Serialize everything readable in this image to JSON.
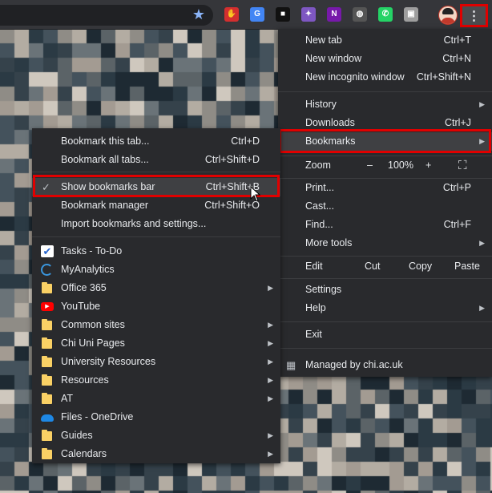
{
  "toolbar": {
    "menu_icon": "⋮",
    "extensions": [
      {
        "name": "adblock-icon",
        "glyph": "✋",
        "color": "#d32f2f"
      },
      {
        "name": "translate-icon",
        "glyph": "G",
        "color": "#4285f4"
      },
      {
        "name": "square-ext-icon",
        "glyph": "■",
        "color": "#111111"
      },
      {
        "name": "puzzle-icon",
        "glyph": "✦",
        "color": "#7e57c2"
      },
      {
        "name": "onenote-icon",
        "glyph": "N",
        "color": "#7719aa"
      },
      {
        "name": "lightbulb-icon",
        "glyph": "◍",
        "color": "#555555"
      },
      {
        "name": "whatsapp-icon",
        "glyph": "✆",
        "color": "#25d366"
      },
      {
        "name": "app-ext-icon",
        "glyph": "▣",
        "color": "#9e9e9e"
      }
    ]
  },
  "chrome_menu": {
    "new_tab": {
      "label": "New tab",
      "shortcut": "Ctrl+T"
    },
    "new_window": {
      "label": "New window",
      "shortcut": "Ctrl+N"
    },
    "new_incognito": {
      "label": "New incognito window",
      "shortcut": "Ctrl+Shift+N"
    },
    "history": {
      "label": "History"
    },
    "downloads": {
      "label": "Downloads",
      "shortcut": "Ctrl+J"
    },
    "bookmarks": {
      "label": "Bookmarks"
    },
    "zoom": {
      "label": "Zoom",
      "minus": "–",
      "value": "100%",
      "plus": "+",
      "fullscreen": "⛶"
    },
    "print": {
      "label": "Print...",
      "shortcut": "Ctrl+P"
    },
    "cast": {
      "label": "Cast..."
    },
    "find": {
      "label": "Find...",
      "shortcut": "Ctrl+F"
    },
    "more_tools": {
      "label": "More tools"
    },
    "edit": {
      "label": "Edit",
      "cut": "Cut",
      "copy": "Copy",
      "paste": "Paste"
    },
    "settings": {
      "label": "Settings"
    },
    "help": {
      "label": "Help"
    },
    "exit": {
      "label": "Exit"
    },
    "managed": {
      "label": "Managed by chi.ac.uk"
    }
  },
  "bookmarks_menu": {
    "bookmark_tab": {
      "label": "Bookmark this tab...",
      "shortcut": "Ctrl+D"
    },
    "bookmark_all": {
      "label": "Bookmark all tabs...",
      "shortcut": "Ctrl+Shift+D"
    },
    "show_bar": {
      "label": "Show bookmarks bar",
      "shortcut": "Ctrl+Shift+B",
      "checked": true
    },
    "manager": {
      "label": "Bookmark manager",
      "shortcut": "Ctrl+Shift+O"
    },
    "import": {
      "label": "Import bookmarks and settings..."
    },
    "items": [
      {
        "label": "Tasks - To-Do",
        "icon": "check-icon",
        "submenu": false
      },
      {
        "label": "MyAnalytics",
        "icon": "myanalytics-icon",
        "submenu": false
      },
      {
        "label": "Office 365",
        "icon": "folder-icon",
        "submenu": true
      },
      {
        "label": "YouTube",
        "icon": "youtube-icon",
        "submenu": false
      },
      {
        "label": "Common sites",
        "icon": "folder-icon",
        "submenu": true
      },
      {
        "label": "Chi Uni Pages",
        "icon": "folder-icon",
        "submenu": true
      },
      {
        "label": "University Resources",
        "icon": "folder-icon",
        "submenu": true
      },
      {
        "label": "Resources",
        "icon": "folder-icon",
        "submenu": true
      },
      {
        "label": "AT",
        "icon": "folder-icon",
        "submenu": true
      },
      {
        "label": "Files - OneDrive",
        "icon": "onedrive-icon",
        "submenu": false
      },
      {
        "label": "Guides",
        "icon": "folder-icon",
        "submenu": true
      },
      {
        "label": "Calendars",
        "icon": "folder-icon",
        "submenu": true
      }
    ]
  }
}
